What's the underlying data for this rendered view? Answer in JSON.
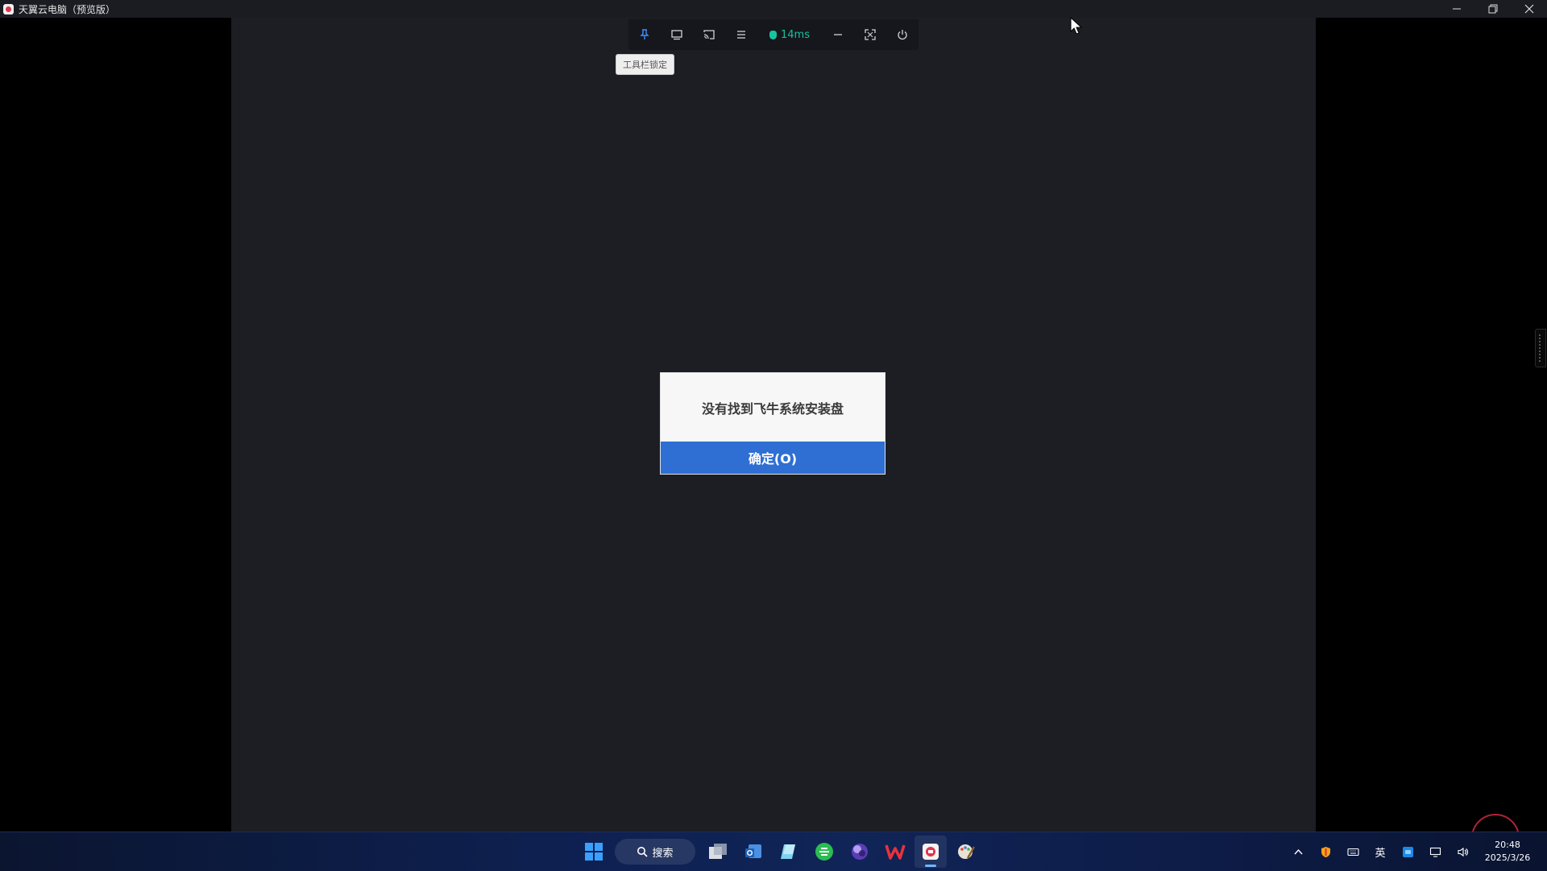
{
  "window": {
    "title": "天翼云电脑（预览版）"
  },
  "toolbar": {
    "latency": "14ms",
    "tooltip": "工具栏锁定",
    "latency_color": "#19c2a0"
  },
  "dialog": {
    "message": "没有找到飞牛系统安装盘",
    "ok_label": "确定(O)",
    "button_color": "#2f6fd4"
  },
  "taskbar": {
    "search_label": "搜索",
    "apps": [
      "windows-start",
      "task-view",
      "outlook",
      "notepad",
      "browser-green",
      "browser-orb",
      "wps",
      "tianyi-cloud-pc",
      "paint"
    ],
    "tray": {
      "ime_label": "英",
      "time": "20:48",
      "date": "2025/3/26"
    }
  }
}
